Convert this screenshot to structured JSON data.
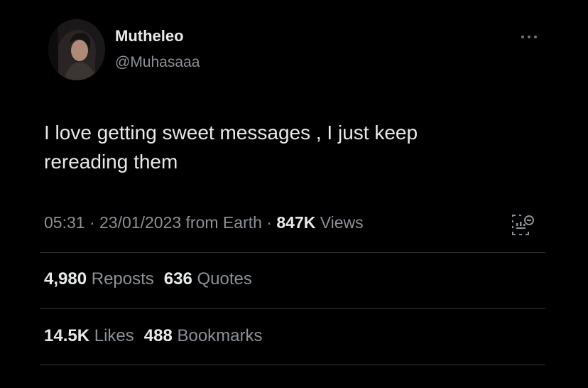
{
  "author": {
    "display_name": "Mutheleo",
    "handle": "@Muhasaaa"
  },
  "tweet": {
    "text_line1": "I love getting sweet messages , I just keep",
    "text_line2": "rereading them"
  },
  "meta": {
    "time": "05:31",
    "separator1": " · ",
    "date": "23/01/2023",
    "source": " from Earth",
    "separator2": " · ",
    "views_count": "847K",
    "views_label": " Views"
  },
  "stats": {
    "reposts_count": "4,980",
    "reposts_label": "Reposts",
    "quotes_count": "636",
    "quotes_label": "Quotes",
    "likes_count": "14.5K",
    "likes_label": "Likes",
    "bookmarks_count": "488",
    "bookmarks_label": "Bookmarks"
  },
  "icons": {
    "more": "more-icon",
    "analytics": "analytics-icon"
  },
  "colors": {
    "background": "#000000",
    "primary_text": "#e7e9ea",
    "secondary_text": "#8b9197",
    "divider": "#2f3336"
  }
}
